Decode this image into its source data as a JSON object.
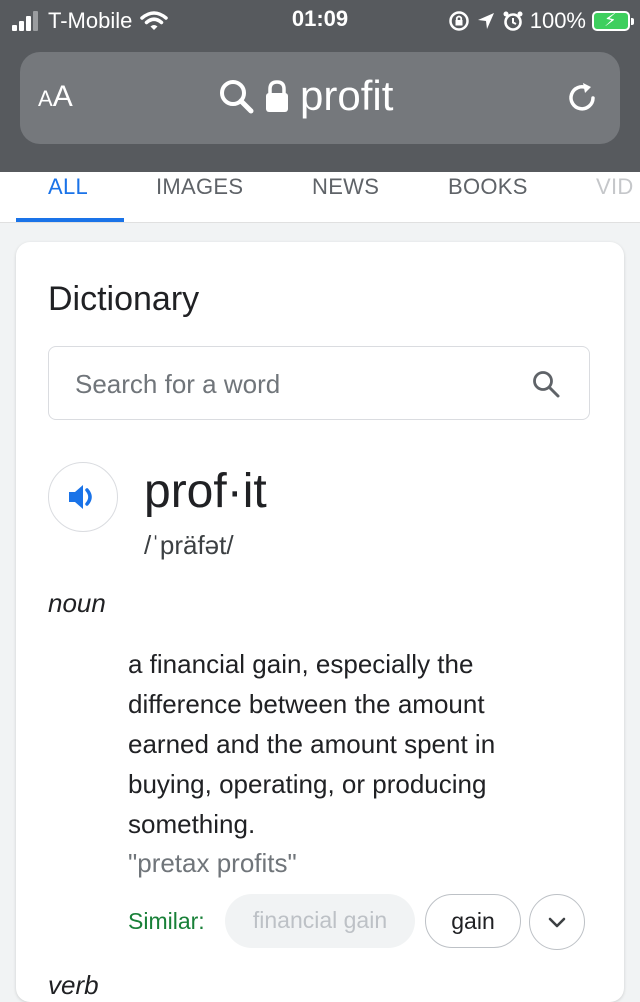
{
  "status_bar": {
    "carrier": "T-Mobile",
    "time": "01:09",
    "battery_percent": "100%"
  },
  "url_bar": {
    "aa_label_small": "A",
    "aa_label_large": "A",
    "query": "profit"
  },
  "tabs": [
    {
      "label": "ALL",
      "selected": true
    },
    {
      "label": "IMAGES"
    },
    {
      "label": "NEWS"
    },
    {
      "label": "BOOKS"
    },
    {
      "label": "VID"
    }
  ],
  "dictionary": {
    "title": "Dictionary",
    "search_placeholder": "Search for a word",
    "headword": "prof·it",
    "phonetic": "/ˈpräfət/",
    "part_of_speech": "noun",
    "definition": "a financial gain, especially the difference between the amount earned and the amount spent in buying, operating, or producing something.",
    "example": "\"pretax profits\"",
    "similar_label": "Similar:",
    "similar": [
      "financial gain",
      "gain"
    ],
    "next_part_of_speech": "verb"
  },
  "colors": {
    "accent": "#1a73e8",
    "similar_green": "#188038",
    "browser_chrome": "#575a5e"
  }
}
